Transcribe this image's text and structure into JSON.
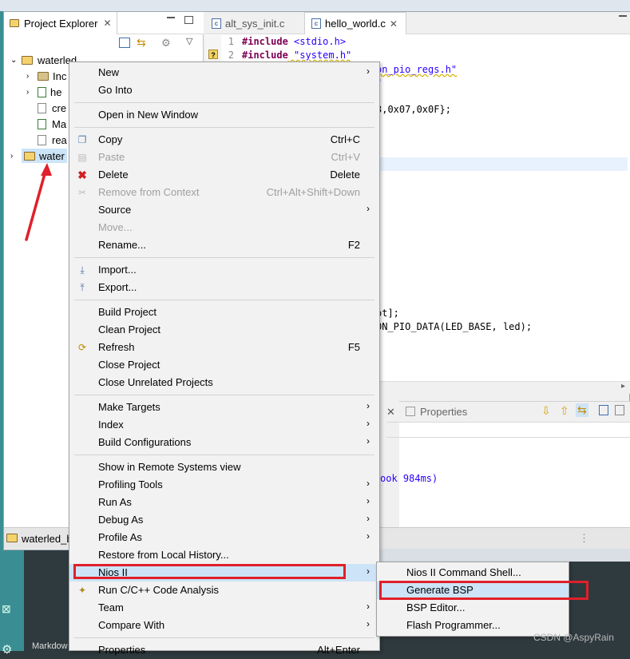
{
  "project_explorer": {
    "tab_title": "Project Explorer",
    "tree": [
      {
        "label": "waterled",
        "level": 0,
        "expanded": true
      },
      {
        "label": "Inc",
        "level": 1
      },
      {
        "label": "he",
        "level": 1
      },
      {
        "label": "cre",
        "level": 1
      },
      {
        "label": "Ma",
        "level": 1
      },
      {
        "label": "rea",
        "level": 1
      },
      {
        "label": "water",
        "level": 0,
        "selected": true
      }
    ],
    "status_item": "waterled_b"
  },
  "editor": {
    "tabs": [
      {
        "label": "alt_sys_init.c",
        "active": false
      },
      {
        "label": "hello_world.c",
        "active": true
      }
    ],
    "line_numbers": [
      "1",
      "2"
    ],
    "lines": [
      {
        "kw": "#include",
        "rest": " <stdio.h>"
      },
      {
        "kw": "#include",
        "rest": " \"system.h\""
      }
    ],
    "fragments": [
      "on_pio_regs.h\"",
      "\"",
      "3,0x07,0x0F};",
      "ot];",
      "ON_PIO_DATA(LED_BASE, led);"
    ]
  },
  "bottom_panel": {
    "properties_tab": "Properties",
    "console_fragment": "ook 984ms)"
  },
  "context_menu": {
    "groups": [
      [
        {
          "label": "New",
          "submenu": true
        },
        {
          "label": "Go Into"
        }
      ],
      [
        {
          "label": "Open in New Window"
        }
      ],
      [
        {
          "label": "Copy",
          "shortcut": "Ctrl+C",
          "icon": "copy-icon"
        },
        {
          "label": "Paste",
          "shortcut": "Ctrl+V",
          "icon": "paste-icon",
          "disabled": true
        },
        {
          "label": "Delete",
          "shortcut": "Delete",
          "icon": "delete-icon"
        },
        {
          "label": "Remove from Context",
          "shortcut": "Ctrl+Alt+Shift+Down",
          "icon": "remove-context-icon",
          "disabled": true
        },
        {
          "label": "Source",
          "submenu": true
        },
        {
          "label": "Move...",
          "disabled": true
        },
        {
          "label": "Rename...",
          "shortcut": "F2"
        }
      ],
      [
        {
          "label": "Import...",
          "icon": "import-icon"
        },
        {
          "label": "Export...",
          "icon": "export-icon"
        }
      ],
      [
        {
          "label": "Build Project"
        },
        {
          "label": "Clean Project"
        },
        {
          "label": "Refresh",
          "shortcut": "F5",
          "icon": "refresh-icon"
        },
        {
          "label": "Close Project"
        },
        {
          "label": "Close Unrelated Projects"
        }
      ],
      [
        {
          "label": "Make Targets",
          "submenu": true
        },
        {
          "label": "Index",
          "submenu": true
        },
        {
          "label": "Build Configurations",
          "submenu": true
        }
      ],
      [
        {
          "label": "Show in Remote Systems view"
        },
        {
          "label": "Profiling Tools",
          "submenu": true
        },
        {
          "label": "Run As",
          "submenu": true
        },
        {
          "label": "Debug As",
          "submenu": true
        },
        {
          "label": "Profile As",
          "submenu": true
        },
        {
          "label": "Restore from Local History..."
        },
        {
          "label": "Nios II",
          "submenu": true,
          "highlighted": true
        },
        {
          "label": "Run C/C++ Code Analysis",
          "icon": "code-analysis-icon"
        },
        {
          "label": "Team",
          "submenu": true
        },
        {
          "label": "Compare With",
          "submenu": true
        }
      ],
      [
        {
          "label": "Properties",
          "shortcut": "Alt+Enter"
        }
      ]
    ]
  },
  "submenu": {
    "items": [
      {
        "label": "Nios II Command Shell..."
      },
      {
        "label": "Generate BSP",
        "highlighted": true
      },
      {
        "label": "BSP Editor..."
      },
      {
        "label": "Flash Programmer..."
      }
    ]
  },
  "watermark": "CSDN @AspyRain",
  "bottom_bar_text": "Markdow",
  "colors": {
    "highlight_red": "#e0202a",
    "keyword": "#7f0055",
    "string": "#2a00ff"
  }
}
